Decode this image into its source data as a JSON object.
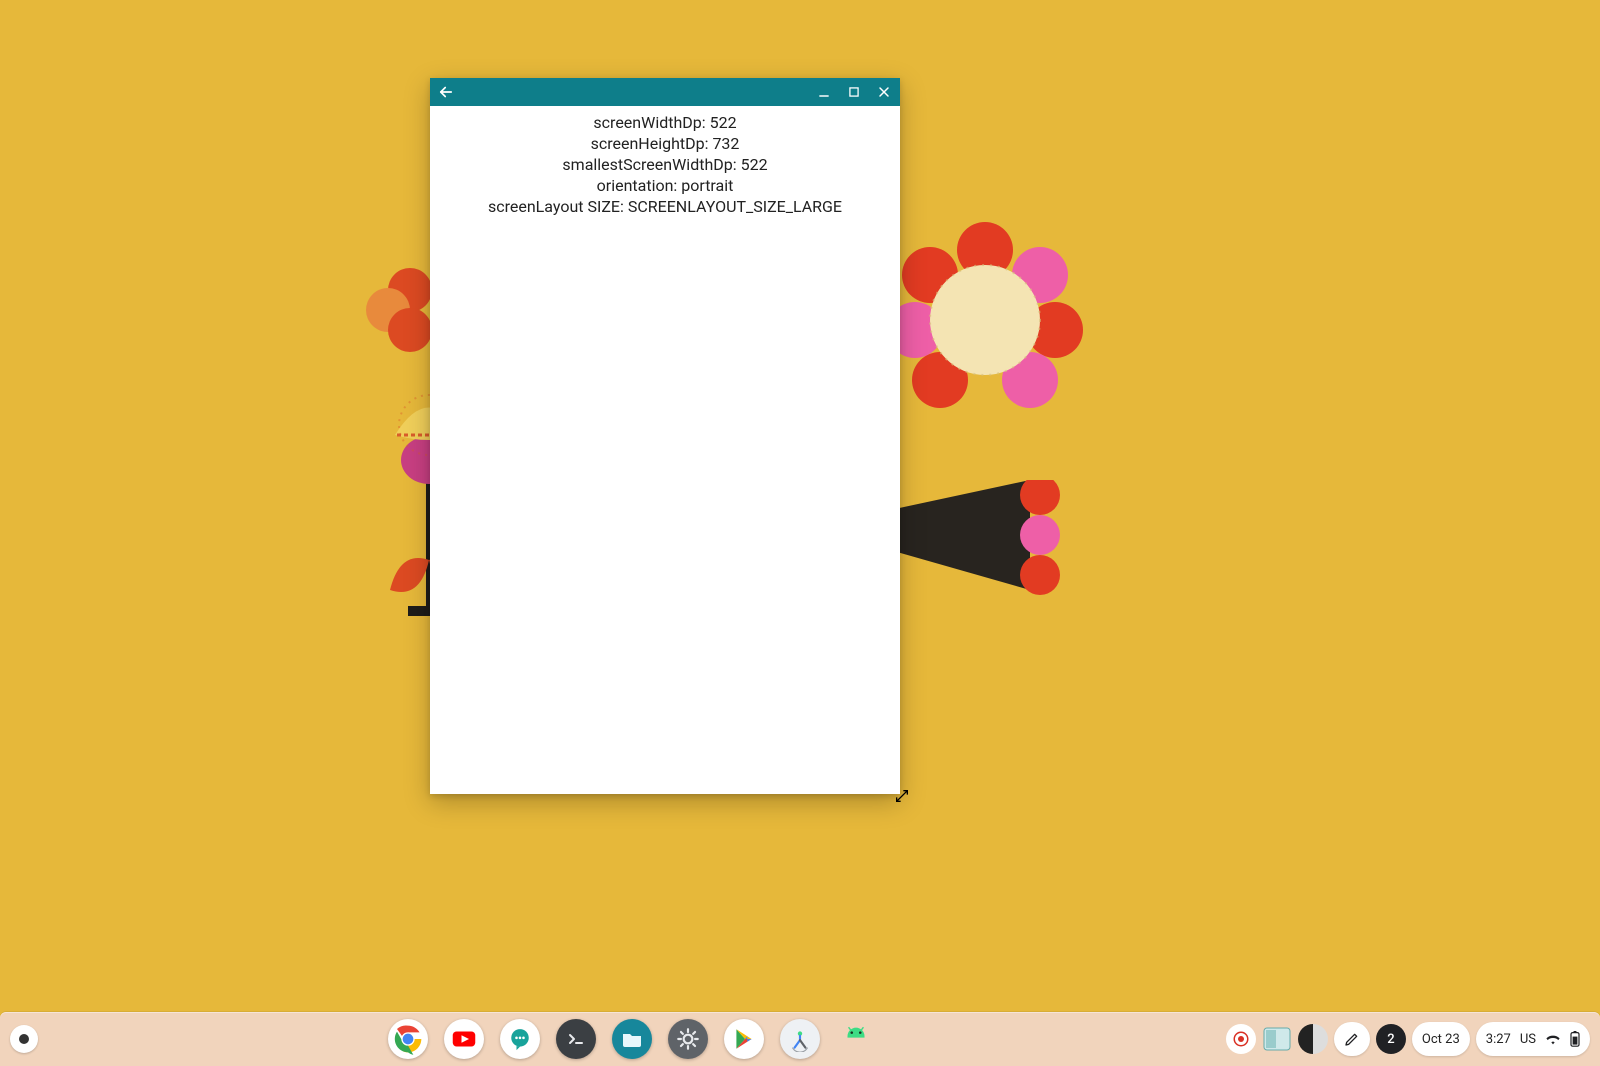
{
  "window": {
    "lines": [
      "screenWidthDp: 522",
      "screenHeightDp: 732",
      "smallestScreenWidthDp: 522",
      "orientation: portrait",
      "screenLayout SIZE: SCREENLAYOUT_SIZE_LARGE"
    ]
  },
  "shelf": {
    "apps": {
      "chrome": "Chrome",
      "youtube": "YouTube",
      "chat": "Chat",
      "terminal": "Terminal",
      "files": "Files",
      "settings": "Settings",
      "play": "Play Store",
      "studio": "Android Studio",
      "android": "Android"
    }
  },
  "tray": {
    "notifications": "2",
    "date": "Oct 23",
    "time": "3:27",
    "input": "US"
  },
  "colors": {
    "titlebar": "#0e7e8a",
    "wallpaper": "#e6b83a",
    "shelf": "rgba(242,214,200,0.92)"
  }
}
